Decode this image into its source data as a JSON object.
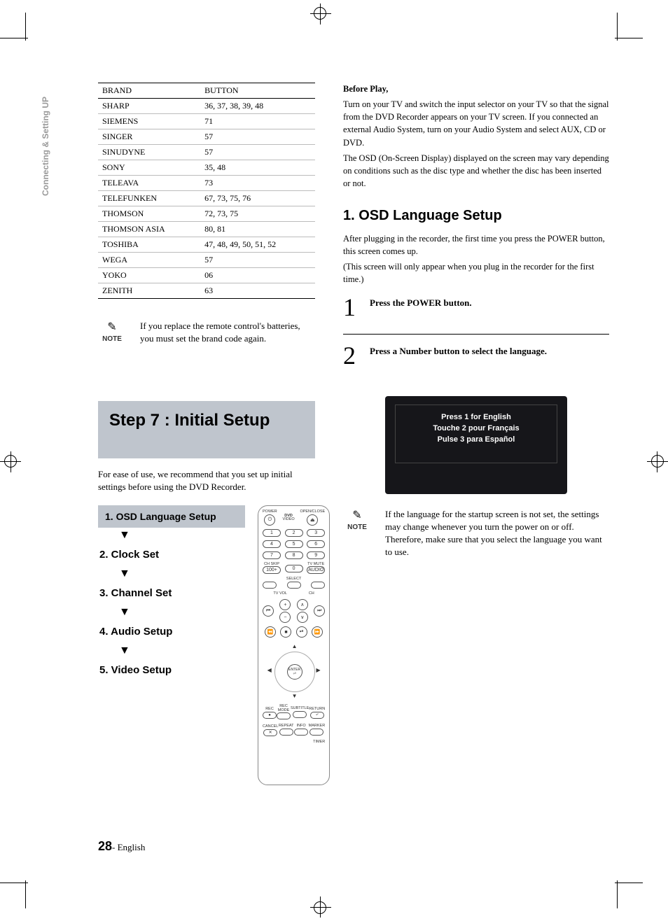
{
  "sideTab": "Connecting & Setting UP",
  "table": {
    "headers": [
      "BRAND",
      "BUTTON"
    ],
    "rows": [
      [
        "SHARP",
        "36, 37, 38, 39, 48"
      ],
      [
        "SIEMENS",
        "71"
      ],
      [
        "SINGER",
        "57"
      ],
      [
        "SINUDYNE",
        "57"
      ],
      [
        "SONY",
        "35, 48"
      ],
      [
        "TELEAVA",
        "73"
      ],
      [
        "TELEFUNKEN",
        "67, 73, 75, 76"
      ],
      [
        "THOMSON",
        "72, 73, 75"
      ],
      [
        "THOMSON ASIA",
        "80, 81"
      ],
      [
        "TOSHIBA",
        "47, 48, 49, 50, 51, 52"
      ],
      [
        "WEGA",
        "57"
      ],
      [
        "YOKO",
        "06"
      ],
      [
        "ZENITH",
        "63"
      ]
    ]
  },
  "note1": {
    "iconLabel": "NOTE",
    "text": "If you replace the remote control's batteries, you must set the brand code again."
  },
  "stepBanner": "Step 7 : Initial Setup",
  "stepIntro": "For ease of use, we recommend that you set up initial settings before using the DVD Recorder.",
  "flow": [
    "1. OSD Language Setup",
    "2. Clock Set",
    "3. Channel Set",
    "4. Audio Setup",
    "5. Video Setup"
  ],
  "remote": {
    "power": "POWER",
    "dvd": "DVD",
    "openclose": "OPEN/CLOSE",
    "video": "VIDEO",
    "nums": [
      "1",
      "2",
      "3",
      "4",
      "5",
      "6",
      "7",
      "8",
      "9",
      "0"
    ],
    "chskip": "CH SKIP",
    "hundred": "100+",
    "tvmute": "TV MUTE",
    "audio": "AUDIO",
    "select": "SELECT",
    "tvvol": "TV VOL",
    "ch": "CH",
    "enter": "ENTER",
    "rec": "REC",
    "recmode": "REC MODE",
    "subtitle": "SUBTITLE",
    "return": "RETURN",
    "cancel": "CANCEL",
    "repeat": "REPEAT",
    "info": "INFO",
    "marker": "MARKER",
    "timer": "TIMER"
  },
  "right": {
    "beforePlayTitle": "Before Play,",
    "beforePlay1": "Turn on your TV and switch the input selector on your TV so that the signal from the DVD Recorder appears on your TV screen. If you connected an external Audio System, turn on your Audio System and select AUX, CD or DVD.",
    "beforePlay2": "The OSD (On-Screen Display) displayed on the screen may vary depending on conditions such as the disc type and whether the disc has been inserted or not.",
    "sectionHead": "1.  OSD Language Setup",
    "sectionBody1": "After plugging in the recorder, the first time you press the POWER button, this screen comes up.",
    "sectionBody2": "(This screen will only appear when you plug in the recorder for the first time.)",
    "step1": {
      "num": "1",
      "text": "Press the POWER button."
    },
    "step2": {
      "num": "2",
      "text": "Press a Number button to select the language."
    },
    "screen": {
      "l1": "Press 1 for English",
      "l2": "Touche 2 pour Français",
      "l3": "Pulse 3 para Español"
    },
    "note2": {
      "iconLabel": "NOTE",
      "text": "If the language for the startup screen is not set, the settings may change whenever you turn the power on or off. Therefore, make sure that you select the language you want to use."
    }
  },
  "footer": {
    "page": "28",
    "lang": "- English"
  }
}
